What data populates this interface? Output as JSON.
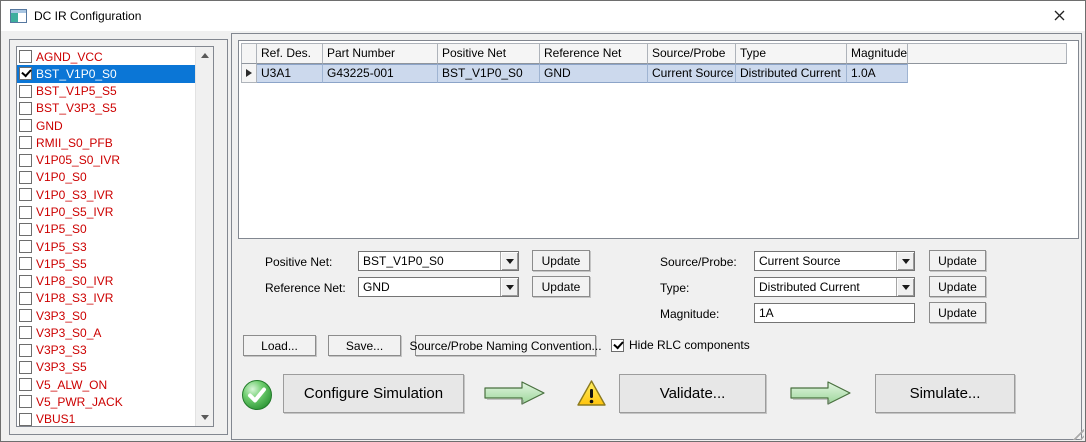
{
  "window": {
    "title": "DC IR Configuration",
    "close_label": "close"
  },
  "net_list": {
    "items": [
      {
        "label": "AGND_VCC",
        "checked": false,
        "selected": false
      },
      {
        "label": "BST_V1P0_S0",
        "checked": true,
        "selected": true
      },
      {
        "label": "BST_V1P5_S5",
        "checked": false,
        "selected": false
      },
      {
        "label": "BST_V3P3_S5",
        "checked": false,
        "selected": false
      },
      {
        "label": "GND",
        "checked": false,
        "selected": false
      },
      {
        "label": "RMII_S0_PFB",
        "checked": false,
        "selected": false
      },
      {
        "label": "V1P05_S0_IVR",
        "checked": false,
        "selected": false
      },
      {
        "label": "V1P0_S0",
        "checked": false,
        "selected": false
      },
      {
        "label": "V1P0_S3_IVR",
        "checked": false,
        "selected": false
      },
      {
        "label": "V1P0_S5_IVR",
        "checked": false,
        "selected": false
      },
      {
        "label": "V1P5_S0",
        "checked": false,
        "selected": false
      },
      {
        "label": "V1P5_S3",
        "checked": false,
        "selected": false
      },
      {
        "label": "V1P5_S5",
        "checked": false,
        "selected": false
      },
      {
        "label": "V1P8_S0_IVR",
        "checked": false,
        "selected": false
      },
      {
        "label": "V1P8_S3_IVR",
        "checked": false,
        "selected": false
      },
      {
        "label": "V3P3_S0",
        "checked": false,
        "selected": false
      },
      {
        "label": "V3P3_S0_A",
        "checked": false,
        "selected": false
      },
      {
        "label": "V3P3_S3",
        "checked": false,
        "selected": false
      },
      {
        "label": "V3P3_S5",
        "checked": false,
        "selected": false
      },
      {
        "label": "V5_ALW_ON",
        "checked": false,
        "selected": false
      },
      {
        "label": "V5_PWR_JACK",
        "checked": false,
        "selected": false
      },
      {
        "label": "VBUS1",
        "checked": false,
        "selected": false
      }
    ]
  },
  "grid": {
    "columns": [
      "Ref. Des.",
      "Part Number",
      "Positive Net",
      "Reference Net",
      "Source/Probe",
      "Type",
      "Magnitude"
    ],
    "rows": [
      [
        "U3A1",
        "G43225-001",
        "BST_V1P0_S0",
        "GND",
        "Current Source",
        "Distributed Current",
        "1.0A"
      ]
    ]
  },
  "form": {
    "positive_net": {
      "label": "Positive Net:",
      "value": "BST_V1P0_S0"
    },
    "reference_net": {
      "label": "Reference Net:",
      "value": "GND"
    },
    "source_probe": {
      "label": "Source/Probe:",
      "value": "Current Source"
    },
    "type": {
      "label": "Type:",
      "value": "Distributed Current"
    },
    "magnitude": {
      "label": "Magnitude:",
      "value": "1A"
    },
    "update_label": "Update"
  },
  "actions": {
    "load": "Load...",
    "save": "Save...",
    "naming_convention": "Source/Probe Naming Convention...",
    "hide_rlc": {
      "label": "Hide RLC components",
      "checked": true
    }
  },
  "flow": {
    "configure": "Configure Simulation",
    "validate": "Validate...",
    "simulate": "Simulate..."
  },
  "colors": {
    "net_text": "#cc0000",
    "list_selection": "#0b76d6",
    "row_selection": "#ccd9ed",
    "arrow_green": "#b9e4b4",
    "status_ok_green": "#3fae49",
    "warning_yellow": "#ffd21e"
  }
}
